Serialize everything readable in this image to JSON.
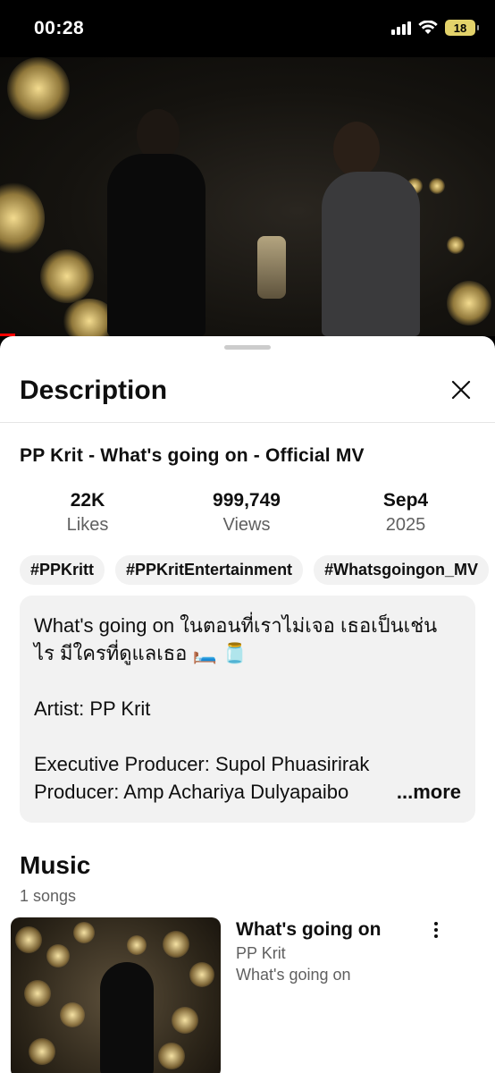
{
  "status_bar": {
    "time": "00:28",
    "battery": "18",
    "icons": [
      "signal-icon",
      "wifi-icon",
      "battery-icon"
    ]
  },
  "video": {
    "progress_fraction": 0.03,
    "progress_color": "#ff0000"
  },
  "sheet": {
    "title": "Description",
    "close_icon": "close-icon"
  },
  "video_info": {
    "title": "PP Krit - What's going on - Official MV",
    "stats": [
      {
        "value": "22K",
        "label": "Likes"
      },
      {
        "value": "999,749",
        "label": "Views"
      },
      {
        "value": "Sep4",
        "label": "2025"
      }
    ],
    "hashtags": [
      "#PPKritt",
      "#PPKritEntertainment",
      "#Whatsgoingon_MV"
    ]
  },
  "description": {
    "line1": "What's going on ในตอนที่เราไม่เจอ เธอเป็นเช่น",
    "line2": "ไร มีใครที่ดูแลเธอ 🛏️ 🫙",
    "artist": "Artist: PP Krit",
    "exec_producer": "Executive Producer: Supol Phuasirirak",
    "producer": "Producer: Amp Achariya Dulyapaibo",
    "more_label": "...more"
  },
  "music": {
    "heading": "Music",
    "count": "1 songs",
    "song": {
      "title": "What's going on",
      "artist": "PP Krit",
      "album": "What's going on"
    }
  }
}
